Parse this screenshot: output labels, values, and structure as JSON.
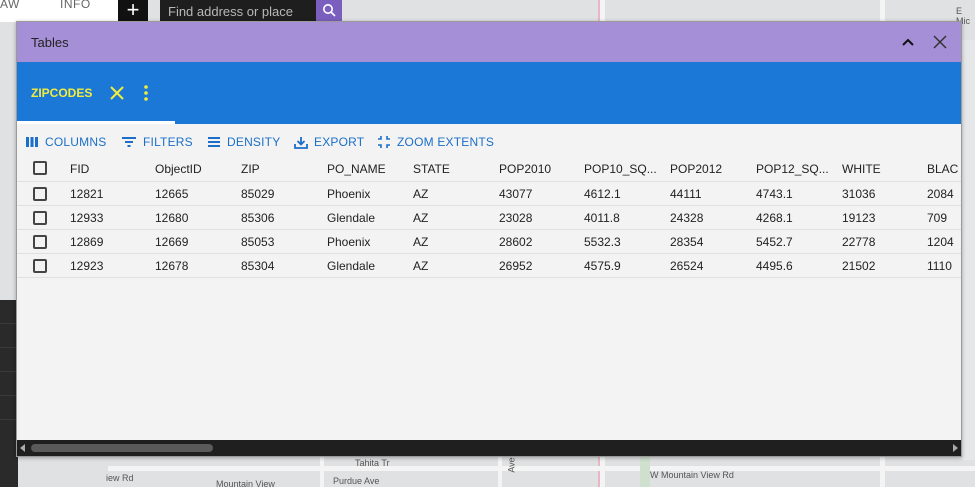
{
  "app": {
    "tabs": [
      {
        "label": "AW"
      },
      {
        "label": "INFO"
      }
    ],
    "search": {
      "placeholder": "Find address or place"
    }
  },
  "map": {
    "labels": [
      {
        "text": "E Mic"
      },
      {
        "text": "iew Rd"
      },
      {
        "text": "Mountain View"
      },
      {
        "text": "Purdue Ave"
      },
      {
        "text": "W Mountain View Rd"
      },
      {
        "text": "Tahita Tr"
      },
      {
        "text": "Ave"
      }
    ]
  },
  "window": {
    "title": "Tables",
    "tab": {
      "label": "ZIPCODES"
    },
    "toolbar": {
      "columns": "COLUMNS",
      "filters": "FILTERS",
      "density": "DENSITY",
      "export": "EXPORT",
      "zoom_extents": "ZOOM EXTENTS"
    }
  },
  "table": {
    "headers": [
      "FID",
      "ObjectID",
      "ZIP",
      "PO_NAME",
      "STATE",
      "POP2010",
      "POP10_SQ...",
      "POP2012",
      "POP12_SQ...",
      "WHITE",
      "BLAC"
    ],
    "rows": [
      [
        "12821",
        "12665",
        "85029",
        "Phoenix",
        "AZ",
        "43077",
        "4612.1",
        "44111",
        "4743.1",
        "31036",
        "2084"
      ],
      [
        "12933",
        "12680",
        "85306",
        "Glendale",
        "AZ",
        "23028",
        "4011.8",
        "24328",
        "4268.1",
        "19123",
        "709"
      ],
      [
        "12869",
        "12669",
        "85053",
        "Phoenix",
        "AZ",
        "28602",
        "5532.3",
        "28354",
        "5452.7",
        "22778",
        "1204"
      ],
      [
        "12923",
        "12678",
        "85304",
        "Glendale",
        "AZ",
        "26952",
        "4575.9",
        "26524",
        "4495.6",
        "21502",
        "1110"
      ]
    ]
  },
  "colors": {
    "title_bar": "#a58fd6",
    "tab_bar": "#1b78d6",
    "tab_label": "#f2ec3c",
    "toolbar_text": "#1b6fc9"
  }
}
